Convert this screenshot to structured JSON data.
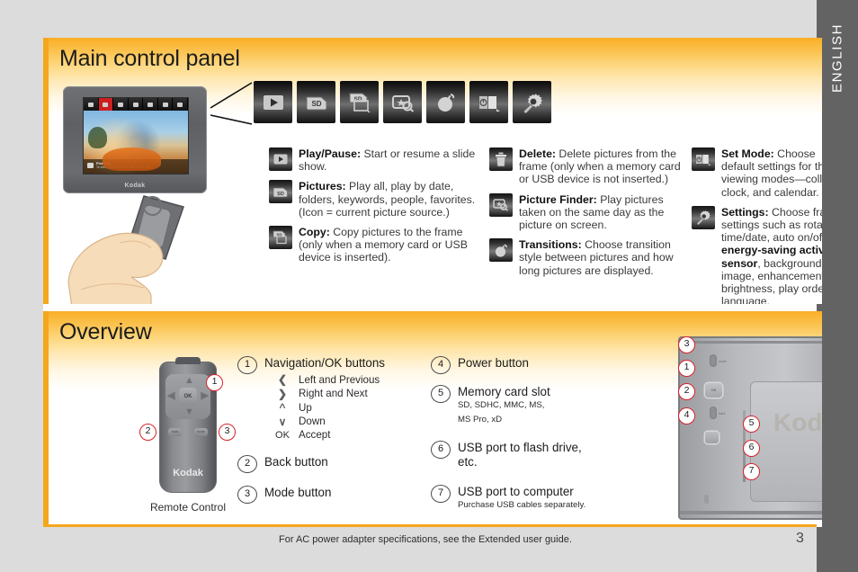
{
  "language_tab": {
    "label": "ENGLISH"
  },
  "sections": {
    "main": {
      "title": "Main control panel",
      "device_caption": "Kodak",
      "screen_status": {
        "title": "Pictures",
        "subtitle": "To view pictures on SD card, press OK"
      },
      "toolbar_icons": [
        {
          "name": "play-pause-icon",
          "label": "Play/Pause"
        },
        {
          "name": "pictures-icon",
          "label": "Pictures"
        },
        {
          "name": "copy-icon",
          "label": "Copy"
        },
        {
          "name": "picture-finder-icon",
          "label": "Picture Finder"
        },
        {
          "name": "transitions-icon",
          "label": "Transitions"
        },
        {
          "name": "set-mode-icon",
          "label": "Set Mode"
        },
        {
          "name": "settings-icon",
          "label": "Settings"
        }
      ],
      "columns": [
        [
          {
            "term": "Play/Pause:",
            "desc": " Start or resume a slide show.",
            "icon": "play-pause-icon"
          },
          {
            "term": "Pictures:",
            "desc": " Play all, play by date, folders, keywords, people, favorites. (Icon = current picture source.)",
            "icon": "pictures-icon"
          },
          {
            "term": "Copy:",
            "desc": " Copy pictures to the frame (only when a memory card or USB device is inserted).",
            "icon": "copy-icon"
          }
        ],
        [
          {
            "term": "Delete:",
            "desc": " Delete pictures from the frame (only when a memory card or USB device is not inserted.)",
            "icon": "delete-icon"
          },
          {
            "term": "Picture Finder:",
            "desc": " Play pictures taken on the same day as the picture on screen.",
            "icon": "picture-finder-icon"
          },
          {
            "term": "Transitions:",
            "desc": " Choose transition style between pictures and how long pictures are displayed.",
            "icon": "transitions-icon"
          }
        ],
        [
          {
            "term": "Set Mode:",
            "desc": " Choose default settings for the viewing modes—collage, clock, and calendar.",
            "icon": "set-mode-icon"
          },
          {
            "term": "Settings:",
            "desc": " Choose frame settings such as rotate, time/date, auto on/off, ",
            "emphasis": "energy-saving activity sensor",
            "desc2": ", background image, enhancements, brightness, play order, language.",
            "icon": "settings-icon"
          }
        ]
      ]
    },
    "overview": {
      "title": "Overview",
      "remote": {
        "caption": "Remote Control",
        "brand": "Kodak",
        "ok_label": "OK",
        "back_label": "back",
        "mode_label": "mode",
        "callouts": [
          "1",
          "2",
          "3"
        ]
      },
      "list_left": [
        {
          "num": "1",
          "label": "Navigation/OK buttons",
          "sub": [
            {
              "key": "‹",
              "value": "Left and Previous"
            },
            {
              "key": "›",
              "value": "Right and Next"
            },
            {
              "key": "ⱏ",
              "value": "Up"
            },
            {
              "key": "ⱟ",
              "value": "Down"
            },
            {
              "key": "OK",
              "value": "Accept"
            }
          ]
        },
        {
          "num": "2",
          "label": "Back button",
          "sub": []
        },
        {
          "num": "3",
          "label": "Mode button",
          "sub": []
        }
      ],
      "list_right": [
        {
          "num": "4",
          "label": "Power button",
          "note": ""
        },
        {
          "num": "5",
          "label": "Memory card slot",
          "note": "SD, SDHC, MMC, MS,",
          "note2": "MS Pro, xD"
        },
        {
          "num": "6",
          "label": "USB port to flash drive, etc.",
          "note": ""
        },
        {
          "num": "7",
          "label": "USB port to computer",
          "note": "Purchase USB cables separately."
        }
      ],
      "back_device": {
        "brand": "Kodak",
        "mode_label": "mode",
        "ok_label": "OK",
        "back_label": "back",
        "callouts_left": [
          "3",
          "1",
          "2",
          "4"
        ],
        "callouts_right": [
          "5",
          "6",
          "7"
        ]
      }
    }
  },
  "footer": {
    "note": "For AC power adapter specifications, see the Extended user guide.",
    "page_number": "3"
  },
  "colors": {
    "accent": "#f5a71c",
    "header_gradient_top": "#f9ae26",
    "tab_grey": "#636363",
    "page_bg": "#dcdcdc",
    "callout_red": "#d8232a"
  }
}
